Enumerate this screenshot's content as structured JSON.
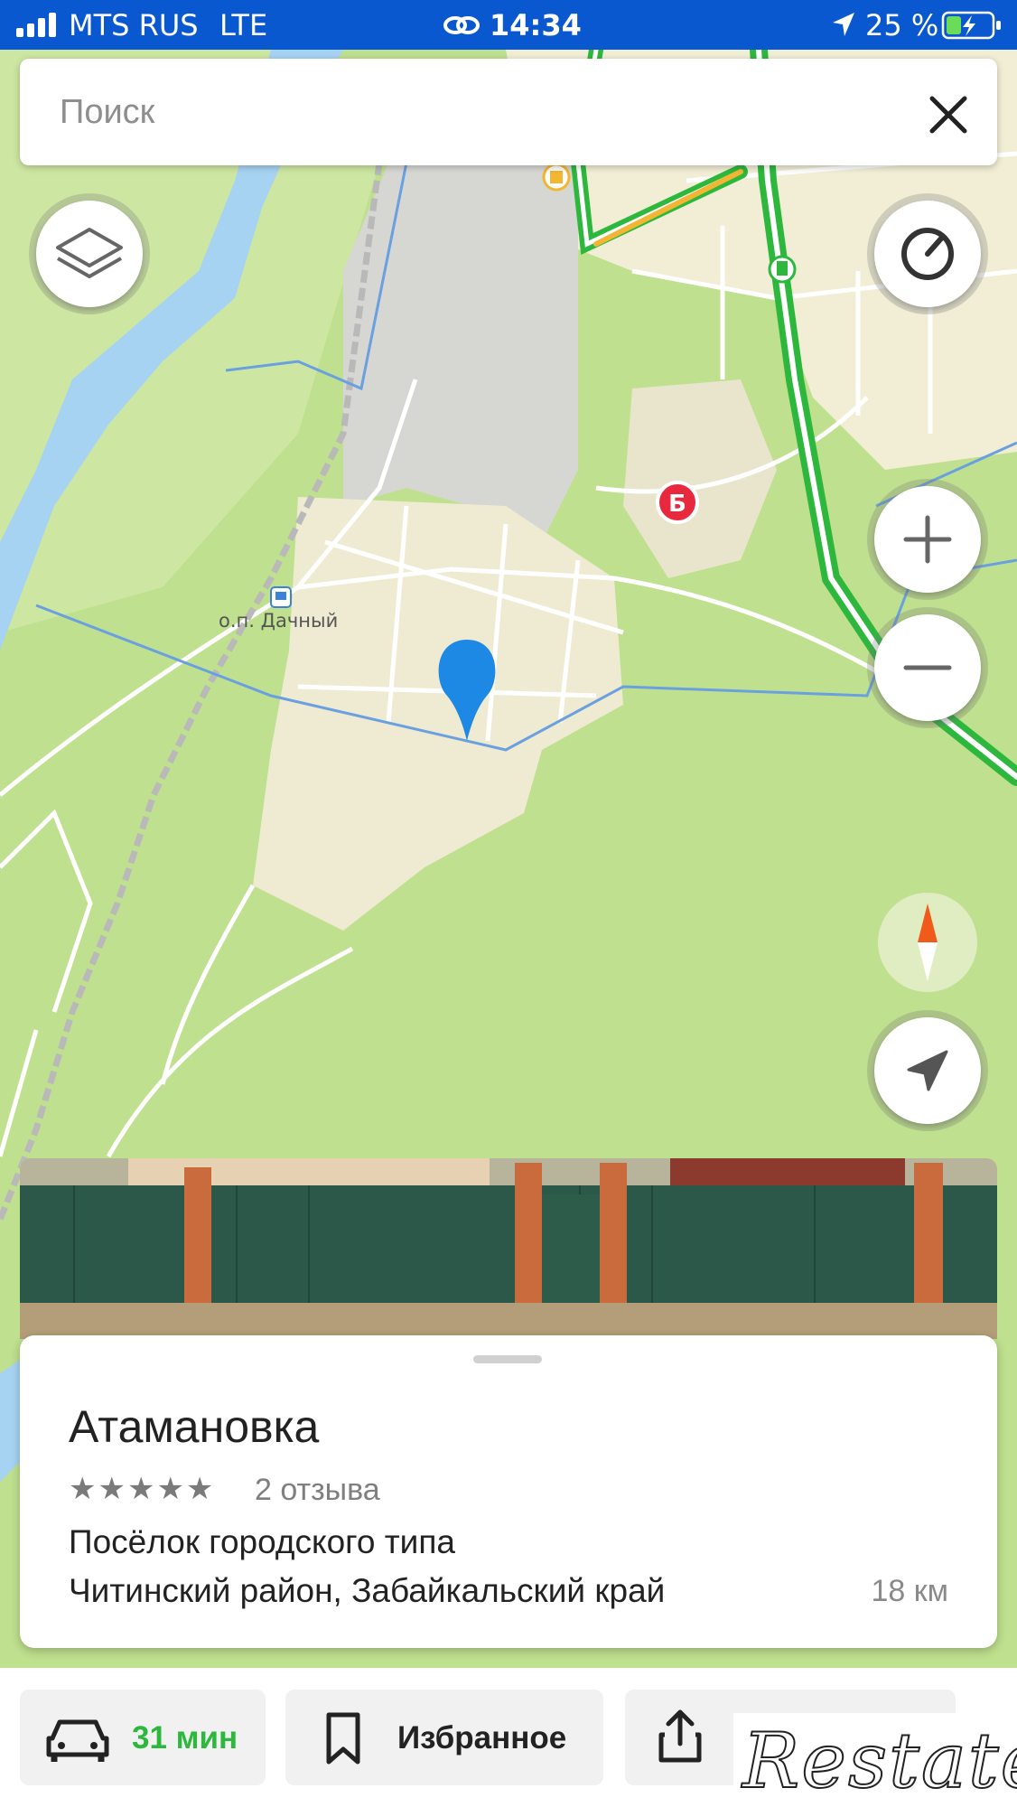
{
  "status_bar": {
    "carrier": "MTS RUS",
    "network": "LTE",
    "time": "14:34",
    "battery": "25 %"
  },
  "search": {
    "placeholder": "Поиск"
  },
  "map": {
    "labels": {
      "station": "о.п. Дачный",
      "pin_b": "Б"
    }
  },
  "card": {
    "title": "Атамановка",
    "stars": "★★★★★",
    "rating": 5,
    "reviews": "2 отзыва",
    "type": "Посёлок городского типа",
    "region": "Читинский район, Забайкальский край",
    "distance": "18 км"
  },
  "actions": {
    "route_time": "31 мин",
    "favorites": "Избранное"
  },
  "watermark": "Restate",
  "colors": {
    "accent_blue": "#0a58d0",
    "map_green": "#bfe08e",
    "route_green": "#2db83d",
    "pin_blue": "#1e88e5"
  }
}
